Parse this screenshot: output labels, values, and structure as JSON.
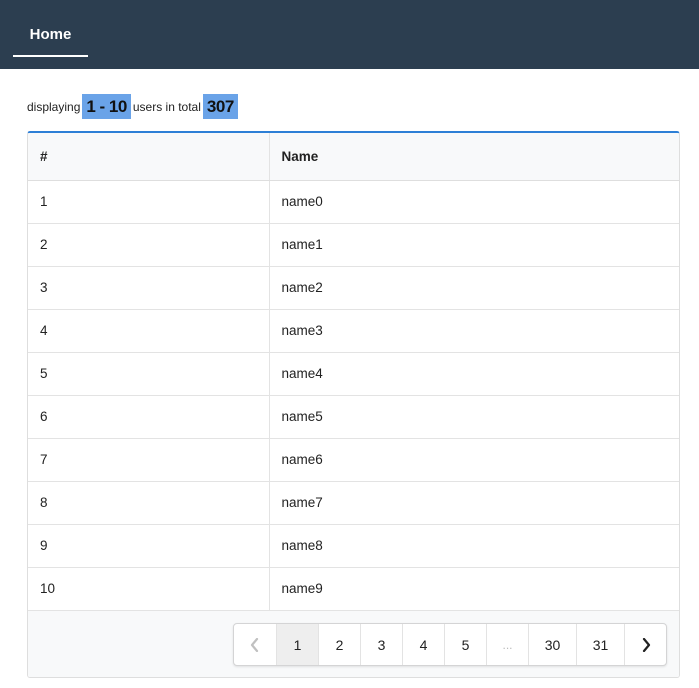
{
  "nav": {
    "home_label": "Home"
  },
  "summary": {
    "prefix": "displaying",
    "range": "1 - 10",
    "middle": "users in total",
    "total": "307"
  },
  "table": {
    "headers": [
      "#",
      "Name"
    ],
    "rows": [
      [
        "1",
        "name0"
      ],
      [
        "2",
        "name1"
      ],
      [
        "3",
        "name2"
      ],
      [
        "4",
        "name3"
      ],
      [
        "5",
        "name4"
      ],
      [
        "6",
        "name5"
      ],
      [
        "7",
        "name6"
      ],
      [
        "8",
        "name7"
      ],
      [
        "9",
        "name8"
      ],
      [
        "10",
        "name9"
      ]
    ]
  },
  "pagination": {
    "prev_icon": "chevron-left-icon",
    "next_icon": "chevron-right-icon",
    "pages": [
      "1",
      "2",
      "3",
      "4",
      "5",
      "...",
      "30",
      "31"
    ],
    "current": "1"
  },
  "colors": {
    "topbar": "#2c3e50",
    "highlight": "#6aa3e8",
    "table_accent": "#2d7fd6"
  }
}
